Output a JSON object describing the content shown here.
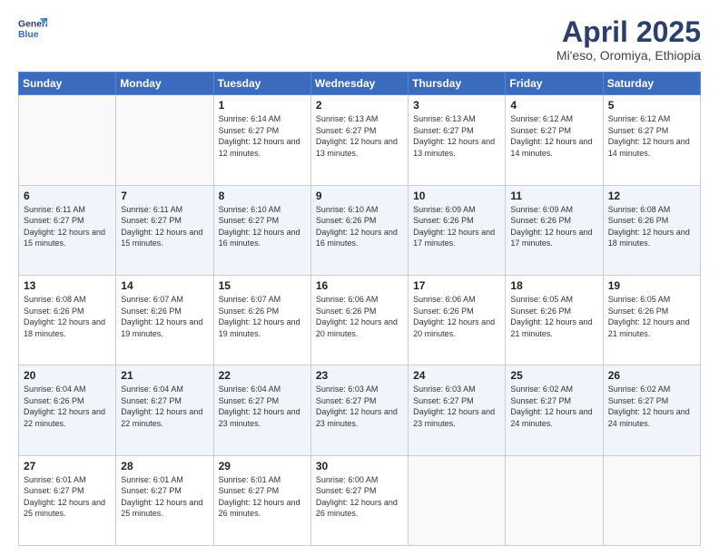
{
  "logo": {
    "line1": "General",
    "line2": "Blue"
  },
  "title": "April 2025",
  "subtitle": "Mi'eso, Oromiya, Ethiopia",
  "days_header": [
    "Sunday",
    "Monday",
    "Tuesday",
    "Wednesday",
    "Thursday",
    "Friday",
    "Saturday"
  ],
  "weeks": [
    [
      {
        "num": "",
        "info": ""
      },
      {
        "num": "",
        "info": ""
      },
      {
        "num": "1",
        "info": "Sunrise: 6:14 AM\nSunset: 6:27 PM\nDaylight: 12 hours and 12 minutes."
      },
      {
        "num": "2",
        "info": "Sunrise: 6:13 AM\nSunset: 6:27 PM\nDaylight: 12 hours and 13 minutes."
      },
      {
        "num": "3",
        "info": "Sunrise: 6:13 AM\nSunset: 6:27 PM\nDaylight: 12 hours and 13 minutes."
      },
      {
        "num": "4",
        "info": "Sunrise: 6:12 AM\nSunset: 6:27 PM\nDaylight: 12 hours and 14 minutes."
      },
      {
        "num": "5",
        "info": "Sunrise: 6:12 AM\nSunset: 6:27 PM\nDaylight: 12 hours and 14 minutes."
      }
    ],
    [
      {
        "num": "6",
        "info": "Sunrise: 6:11 AM\nSunset: 6:27 PM\nDaylight: 12 hours and 15 minutes."
      },
      {
        "num": "7",
        "info": "Sunrise: 6:11 AM\nSunset: 6:27 PM\nDaylight: 12 hours and 15 minutes."
      },
      {
        "num": "8",
        "info": "Sunrise: 6:10 AM\nSunset: 6:27 PM\nDaylight: 12 hours and 16 minutes."
      },
      {
        "num": "9",
        "info": "Sunrise: 6:10 AM\nSunset: 6:26 PM\nDaylight: 12 hours and 16 minutes."
      },
      {
        "num": "10",
        "info": "Sunrise: 6:09 AM\nSunset: 6:26 PM\nDaylight: 12 hours and 17 minutes."
      },
      {
        "num": "11",
        "info": "Sunrise: 6:09 AM\nSunset: 6:26 PM\nDaylight: 12 hours and 17 minutes."
      },
      {
        "num": "12",
        "info": "Sunrise: 6:08 AM\nSunset: 6:26 PM\nDaylight: 12 hours and 18 minutes."
      }
    ],
    [
      {
        "num": "13",
        "info": "Sunrise: 6:08 AM\nSunset: 6:26 PM\nDaylight: 12 hours and 18 minutes."
      },
      {
        "num": "14",
        "info": "Sunrise: 6:07 AM\nSunset: 6:26 PM\nDaylight: 12 hours and 19 minutes."
      },
      {
        "num": "15",
        "info": "Sunrise: 6:07 AM\nSunset: 6:26 PM\nDaylight: 12 hours and 19 minutes."
      },
      {
        "num": "16",
        "info": "Sunrise: 6:06 AM\nSunset: 6:26 PM\nDaylight: 12 hours and 20 minutes."
      },
      {
        "num": "17",
        "info": "Sunrise: 6:06 AM\nSunset: 6:26 PM\nDaylight: 12 hours and 20 minutes."
      },
      {
        "num": "18",
        "info": "Sunrise: 6:05 AM\nSunset: 6:26 PM\nDaylight: 12 hours and 21 minutes."
      },
      {
        "num": "19",
        "info": "Sunrise: 6:05 AM\nSunset: 6:26 PM\nDaylight: 12 hours and 21 minutes."
      }
    ],
    [
      {
        "num": "20",
        "info": "Sunrise: 6:04 AM\nSunset: 6:26 PM\nDaylight: 12 hours and 22 minutes."
      },
      {
        "num": "21",
        "info": "Sunrise: 6:04 AM\nSunset: 6:27 PM\nDaylight: 12 hours and 22 minutes."
      },
      {
        "num": "22",
        "info": "Sunrise: 6:04 AM\nSunset: 6:27 PM\nDaylight: 12 hours and 23 minutes."
      },
      {
        "num": "23",
        "info": "Sunrise: 6:03 AM\nSunset: 6:27 PM\nDaylight: 12 hours and 23 minutes."
      },
      {
        "num": "24",
        "info": "Sunrise: 6:03 AM\nSunset: 6:27 PM\nDaylight: 12 hours and 23 minutes."
      },
      {
        "num": "25",
        "info": "Sunrise: 6:02 AM\nSunset: 6:27 PM\nDaylight: 12 hours and 24 minutes."
      },
      {
        "num": "26",
        "info": "Sunrise: 6:02 AM\nSunset: 6:27 PM\nDaylight: 12 hours and 24 minutes."
      }
    ],
    [
      {
        "num": "27",
        "info": "Sunrise: 6:01 AM\nSunset: 6:27 PM\nDaylight: 12 hours and 25 minutes."
      },
      {
        "num": "28",
        "info": "Sunrise: 6:01 AM\nSunset: 6:27 PM\nDaylight: 12 hours and 25 minutes."
      },
      {
        "num": "29",
        "info": "Sunrise: 6:01 AM\nSunset: 6:27 PM\nDaylight: 12 hours and 26 minutes."
      },
      {
        "num": "30",
        "info": "Sunrise: 6:00 AM\nSunset: 6:27 PM\nDaylight: 12 hours and 26 minutes."
      },
      {
        "num": "",
        "info": ""
      },
      {
        "num": "",
        "info": ""
      },
      {
        "num": "",
        "info": ""
      }
    ]
  ]
}
